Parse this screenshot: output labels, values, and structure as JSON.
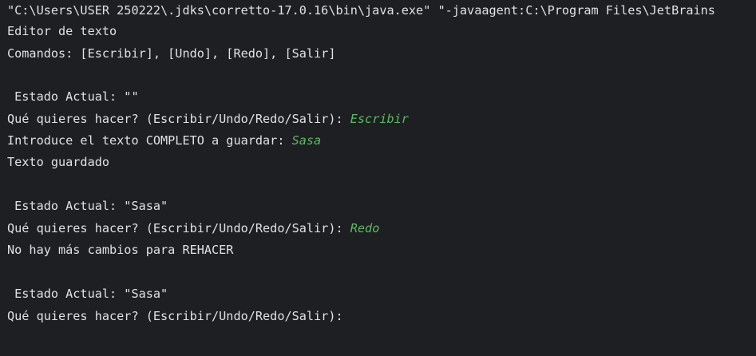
{
  "console": {
    "command_line": "\"C:\\Users\\USER 250222\\.jdks\\corretto-17.0.16\\bin\\java.exe\" \"-javaagent:C:\\Program Files\\JetBrains",
    "title_line": "Editor de texto",
    "commands_line": "Comandos: [Escribir], [Undo], [Redo], [Salir]",
    "state_1": " Estado Actual: \"\"",
    "prompt_1": "Qué quieres hacer? (Escribir/Undo/Redo/Salir): ",
    "input_1": "Escribir",
    "text_prompt": "Introduce el texto COMPLETO a guardar: ",
    "input_2": "Sasa",
    "saved_msg": "Texto guardado",
    "state_2": " Estado Actual: \"Sasa\"",
    "prompt_2": "Qué quieres hacer? (Escribir/Undo/Redo/Salir): ",
    "input_3": "Redo",
    "no_redo_msg": "No hay más cambios para REHACER",
    "state_3": " Estado Actual: \"Sasa\"",
    "prompt_3": "Qué quieres hacer? (Escribir/Undo/Redo/Salir): "
  },
  "colors": {
    "background": "#1e1f22",
    "output_text": "#dfe1e5",
    "user_input": "#5fb865"
  }
}
